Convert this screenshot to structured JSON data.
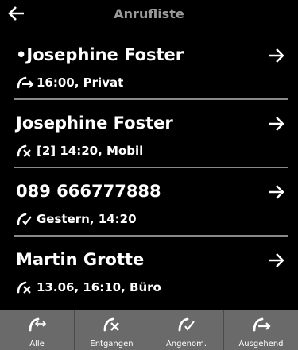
{
  "header": {
    "title": "Anrufliste",
    "back_icon": "back-arrow-icon"
  },
  "calls": [
    {
      "name": "•Josephine Foster",
      "icon": "outgoing-call-icon",
      "info": "16:00, Privat"
    },
    {
      "name": "Josephine Foster",
      "icon": "missed-call-icon",
      "info": "[2] 14:20, Mobil"
    },
    {
      "name": "089 666777888",
      "icon": "accepted-call-icon",
      "info": "Gestern, 14:20"
    },
    {
      "name": "Martin Grotte",
      "icon": "missed-call-icon",
      "info": "13.06, 16:10, Büro"
    }
  ],
  "tabs": [
    {
      "label": "Alle",
      "icon": "all-calls-icon"
    },
    {
      "label": "Entgangen",
      "icon": "missed-call-icon"
    },
    {
      "label": "Angenom.",
      "icon": "accepted-call-icon"
    },
    {
      "label": "Ausgehend",
      "icon": "outgoing-call-icon"
    }
  ],
  "colors": {
    "background": "#000000",
    "title": "#9a9a9a",
    "tabbar": "#6a6a6a",
    "divider": "#8a8a8a"
  }
}
